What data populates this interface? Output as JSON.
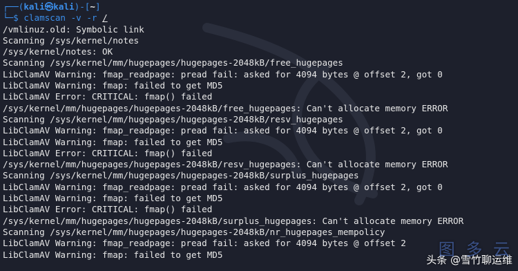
{
  "prompt": {
    "corner_top": "┌──(",
    "user": "kali",
    "at": "㉿",
    "host": "kali",
    "close_paren": ")-[",
    "cwd": "~",
    "close_bracket": "]",
    "corner_bottom": "└─",
    "dollar": "$ ",
    "command": "clamscan -v -r ",
    "arg": "/"
  },
  "output_lines": [
    "/vmlinuz.old: Symbolic link",
    "Scanning /sys/kernel/notes",
    "/sys/kernel/notes: OK",
    "Scanning /sys/kernel/mm/hugepages/hugepages-2048kB/free_hugepages",
    "LibClamAV Warning: fmap_readpage: pread fail: asked for 4094 bytes @ offset 2, got 0",
    "LibClamAV Warning: fmap: failed to get MD5",
    "LibClamAV Error: CRITICAL: fmap() failed",
    "/sys/kernel/mm/hugepages/hugepages-2048kB/free_hugepages: Can't allocate memory ERROR",
    "Scanning /sys/kernel/mm/hugepages/hugepages-2048kB/resv_hugepages",
    "LibClamAV Warning: fmap_readpage: pread fail: asked for 4094 bytes @ offset 2, got 0",
    "LibClamAV Warning: fmap: failed to get MD5",
    "LibClamAV Error: CRITICAL: fmap() failed",
    "/sys/kernel/mm/hugepages/hugepages-2048kB/resv_hugepages: Can't allocate memory ERROR",
    "Scanning /sys/kernel/mm/hugepages/hugepages-2048kB/surplus_hugepages",
    "LibClamAV Warning: fmap_readpage: pread fail: asked for 4094 bytes @ offset 2, got 0",
    "LibClamAV Warning: fmap: failed to get MD5",
    "LibClamAV Error: CRITICAL: fmap() failed",
    "/sys/kernel/mm/hugepages/hugepages-2048kB/surplus_hugepages: Can't allocate memory ERROR",
    "Scanning /sys/kernel/mm/hugepages/hugepages-2048kB/nr_hugepages_mempolicy",
    "LibClamAV Warning: fmap_readpage: pread fail: asked for 4094 bytes @ offset 2",
    "LibClamAV Warning: fmap: failed to get MD5"
  ],
  "watermark": {
    "text": "头条 @雪竹聊运维",
    "logo": "图 多 云"
  },
  "colors": {
    "background": "#1d202c",
    "prompt_accent": "#3b8eea",
    "text": "#e8e8e8"
  }
}
